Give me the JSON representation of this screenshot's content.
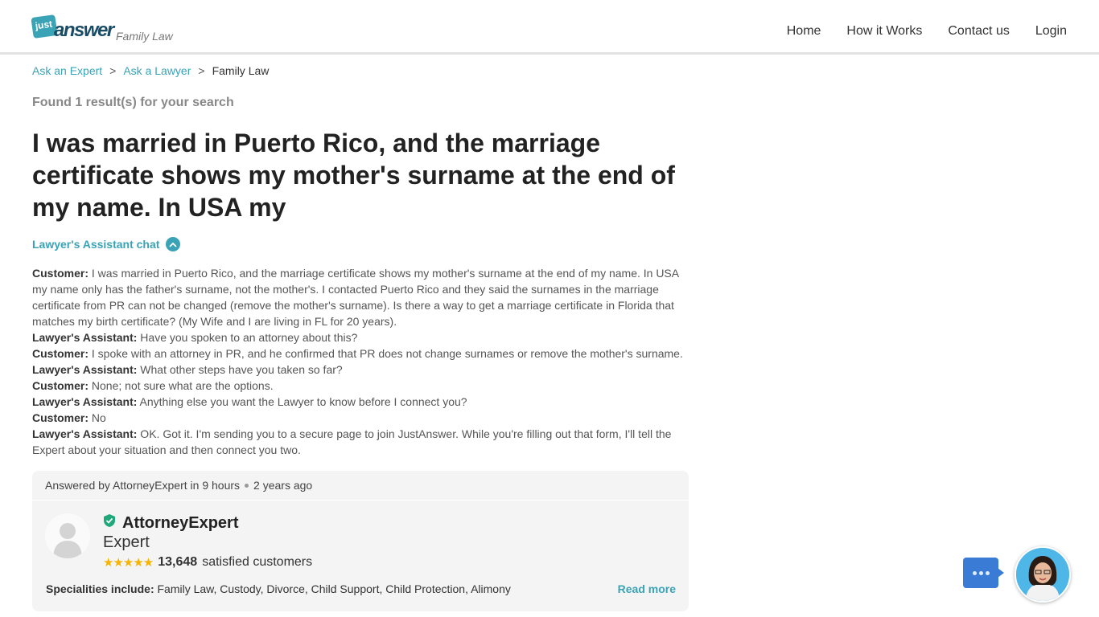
{
  "brand": {
    "logo_badge": "just",
    "logo_word": "answer",
    "category": "Family Law",
    "accent_color": "#3aa3b5"
  },
  "nav": {
    "home": "Home",
    "how_it_works": "How it Works",
    "contact": "Contact us",
    "login": "Login"
  },
  "breadcrumb": {
    "items": [
      "Ask an Expert",
      "Ask a Lawyer",
      "Family Law"
    ],
    "separator": ">"
  },
  "search": {
    "found": "Found 1 result(s) for your search"
  },
  "question": {
    "title": "I was married in Puerto Rico, and the marriage certificate shows my mother's surname at the end of my name. In USA my"
  },
  "assistant_chat": {
    "toggle_label": "Lawyer's Assistant chat",
    "messages": [
      {
        "speaker": "Customer:",
        "text": " I was married in Puerto Rico, and the marriage certificate shows my mother's surname at the end of my name. In USA my name only has the father's surname, not the mother's. I contacted Puerto Rico and they said the surnames in the marriage certificate from PR can not be changed (remove the mother's surname). Is there a way to get a marriage certificate in Florida that matches my birth certificate? (My Wife and I are living in FL for 20 years)."
      },
      {
        "speaker": "Lawyer's Assistant:",
        "text": " Have you spoken to an attorney about this?"
      },
      {
        "speaker": "Customer:",
        "text": " I spoke with an attorney in PR, and he confirmed that PR does not change surnames or remove the mother's surname."
      },
      {
        "speaker": "Lawyer's Assistant:",
        "text": " What other steps have you taken so far?"
      },
      {
        "speaker": "Customer:",
        "text": " None; not sure what are the options."
      },
      {
        "speaker": "Lawyer's Assistant:",
        "text": " Anything else you want the Lawyer to know before I connect you?"
      },
      {
        "speaker": "Customer:",
        "text": " No"
      },
      {
        "speaker": "Lawyer's Assistant:",
        "text": " OK. Got it. I'm sending you to a secure page to join JustAnswer. While you're filling out that form, I'll tell the Expert about your situation and then connect you two."
      }
    ]
  },
  "answer": {
    "answered_by": "Answered by AttorneyExpert in 9 hours",
    "time_ago": "2 years ago",
    "expert_name": "AttorneyExpert",
    "expert_title": "Expert",
    "stars": "★★★★★",
    "satisfied_count": "13,648",
    "satisfied_label": "satisfied customers",
    "specialities_label": "Specialities include:",
    "specialities": "Family Law, Custody, Divorce, Child Support, Child Protection, Alimony",
    "read_more": "Read more",
    "verified_color": "#1fa87a",
    "star_color": "#f5b400"
  },
  "chat_widget": {
    "bubble_color": "#3a7bd5",
    "icon": "ellipsis-icon"
  }
}
